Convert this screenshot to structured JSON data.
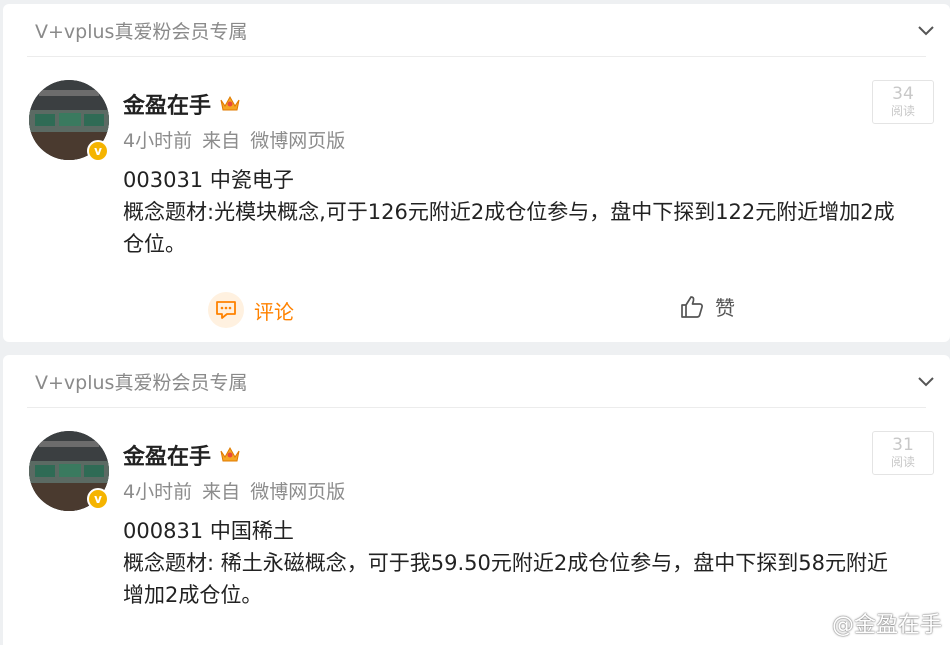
{
  "posts": [
    {
      "group_label": "V+vplus真爱粉会员专属",
      "author": "金盈在手",
      "time": "4小时前",
      "source_prefix": "来自",
      "source": "微博网页版",
      "read_count": "34",
      "read_label": "阅读",
      "lines": [
        "003031 中瓷电子",
        "概念题材:光模块概念,可于126元附近2成仓位参与，盘中下探到122元附近增加2成",
        "仓位。"
      ],
      "comment_label": "评论",
      "like_label": "赞"
    },
    {
      "group_label": "V+vplus真爱粉会员专属",
      "author": "金盈在手",
      "time": "4小时前",
      "source_prefix": "来自",
      "source": "微博网页版",
      "read_count": "31",
      "read_label": "阅读",
      "lines": [
        "000831 中国稀土",
        "概念题材: 稀土永磁概念，可于我59.50元附近2成仓位参与，盘中下探到58元附近",
        "增加2成仓位。"
      ]
    }
  ],
  "watermark": {
    "text": "@金盈在手",
    "icon": "weibo-logo-icon"
  },
  "colors": {
    "accent": "#ff8200",
    "badge": "#f5b400",
    "muted": "#8c8c8c"
  }
}
